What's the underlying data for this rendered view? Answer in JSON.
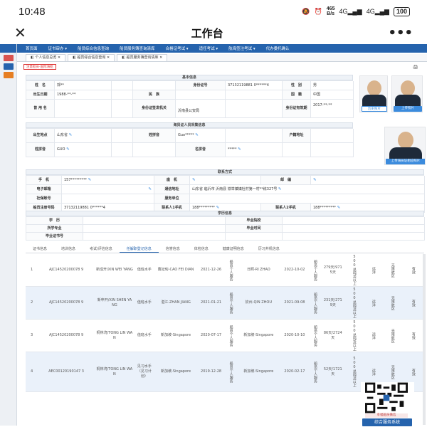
{
  "status_bar": {
    "time": "10:48",
    "speed_value": "465",
    "speed_unit": "B/s",
    "net1": "4G",
    "net2": "4G",
    "battery": "100"
  },
  "app_bar": {
    "title": "工作台"
  },
  "top_nav": [
    "首页面",
    "证书审办 ▾",
    "船员综合信息查询",
    "船员服务簿查询清库",
    "合格证考试 ▾",
    "适任考试 ▾",
    "航海签注考试 ▾",
    "代办委托确认"
  ],
  "tabs": [
    "◧ 个人信息总览 ✕",
    "◧ 船员综合信息查询 ✕",
    "◧ 船员服务簿查询清库 ✕"
  ],
  "back_button": "注意船员-国际海船",
  "basic": {
    "title": "基本信息",
    "name_label": "姓　名",
    "name_value": "郭**",
    "id_label": "身份证号",
    "id_value": "37132119881 0******4",
    "gender_label": "性　别",
    "gender_value": "男",
    "birth_label": "出生日期",
    "birth_value": "1988-**-**",
    "ethnic_label": "民　族",
    "nation_label": "国　籍",
    "nation_value": "中国",
    "former_label": "曾 用 名",
    "issuer_label": "身份证签发机关",
    "issuer_value": "沂南县公安局",
    "validity_label": "身份证有效期",
    "validity_value": "2017-**-**",
    "photo1_btn": "历史照片",
    "photo2_btn": "上传照片"
  },
  "seafarer": {
    "title": "海员证人员采集信息",
    "birthplace_label": "出生地点",
    "birthplace_value": "山东省",
    "surname_py_label": "姓拼音",
    "surname_py_value": "Guo*****",
    "household_label": "户籍地址",
    "firstname_label": "姓拼音",
    "firstname_value": "GUO",
    "given_py_label": "名拼音",
    "given_py_value": "*****",
    "photo_btn": "上传海员证相应照片"
  },
  "contact": {
    "title": "联系方式",
    "mobile_label": "手　机",
    "mobile_value": "157*********",
    "landline_label": "座　机",
    "post_label": "邮　编",
    "email_label": "电子邮箱",
    "address_label": "通信地址",
    "address_value": "山东省 临沂市 沂南县 铁举镇镇杜村第一村**栋327号",
    "wechat_label": "社保账号",
    "service_label": "服务单位",
    "reg_label": "船员注册号码",
    "reg_value": "37132119881 0******4",
    "contact1_label": "联系人1手机",
    "contact1_value": "188*********",
    "contact2_label": "联系人2手机",
    "contact2_value": "188*********"
  },
  "education": {
    "title": "学历信息",
    "degree_label": "学　历",
    "school_label": "毕业院校",
    "major_label": "所学专业",
    "grad_label": "毕业时间",
    "cert_label": "毕业证书号"
  },
  "bottom_tabs": [
    "证书信息",
    "培训信息",
    "考试/评估信息",
    "任解职登记信息",
    "信誉信息",
    "体检信息",
    "健康证明信息",
    "历习并机信息"
  ],
  "records": [
    {
      "no": "1",
      "id": "AJC14520200078 9",
      "company": "新成开/XIN WEI YANG",
      "role": "值班水手",
      "ship": "曹妃甸-CAO FEI DIAN",
      "start": "2021-12-26",
      "type1": "船员个人服务",
      "port2": "日照-RI ZHAO",
      "end": "2022-10-02",
      "type2": "船员个人服务",
      "days": "279天/9715天",
      "ton": "500总吨及以上",
      "route": "远洋",
      "area": "无限航区",
      "status": "有效"
    },
    {
      "no": "2",
      "id": "AJC14520200078 9",
      "company": "新申开/XIN SHEN YANG",
      "role": "值班水手",
      "ship": "湛江-ZHAN JIANG",
      "start": "2021-01-21",
      "type1": "船员个人服务",
      "port2": "钦州-QIN ZHOU",
      "end": "2021-09-08",
      "type2": "船员个人服务",
      "days": "231天/2719天",
      "ton": "500总吨及以上",
      "route": "远洋",
      "area": "无限航区",
      "status": "有效"
    },
    {
      "no": "3",
      "id": "AJC14520200078 9",
      "company": "桐林湾/TONG LIN WAN",
      "role": "值班水手",
      "ship": "新加坡-Singapore",
      "start": "2020-07-17",
      "type1": "船员个人服务",
      "port2": "新加坡-Singapore",
      "end": "2020-10-10",
      "type2": "船员个人服务",
      "days": "86天/2724天",
      "ton": "500总吨及以上",
      "route": "远洋",
      "area": "无限航区",
      "status": "有效"
    },
    {
      "no": "4",
      "id": "AEC00120190147 3",
      "company": "桐林湾/TONG LIN WAN",
      "role": "见习水手（见习计划）",
      "ship": "新加坡-Singapore",
      "start": "2019-12-28",
      "type1": "船员个人服务",
      "port2": "新加坡-Singapore",
      "end": "2020-02-17",
      "type2": "船员个人服务",
      "days": "52天/1721天",
      "ton": "500总吨及以上",
      "route": "远洋",
      "area": "无限航区",
      "status": "有效"
    }
  ],
  "qr": {
    "caption": "幸福船员微信",
    "button": "综合服务系统"
  }
}
